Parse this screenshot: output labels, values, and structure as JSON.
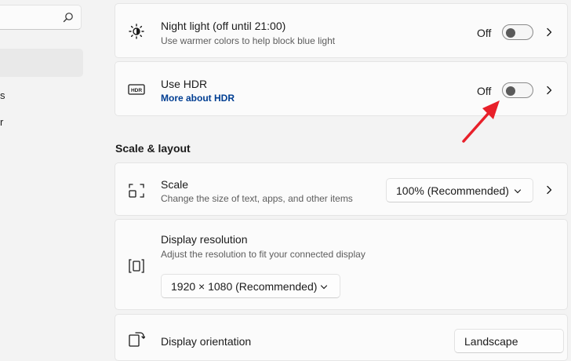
{
  "sidebar": {
    "search_icon": "search-icon",
    "nav_fragments": [
      "s",
      "r"
    ]
  },
  "night_light": {
    "icon": "brightness-icon",
    "title": "Night light (off until 21:00)",
    "subtitle": "Use warmer colors to help block blue light",
    "state": "Off",
    "enabled": false
  },
  "hdr": {
    "icon": "hdr-icon",
    "icon_text": "HDR",
    "title": "Use HDR",
    "link": "More about HDR",
    "state": "Off",
    "enabled": false
  },
  "scale_layout": {
    "heading": "Scale & layout",
    "scale": {
      "icon": "scale-icon",
      "title": "Scale",
      "subtitle": "Change the size of text, apps, and other items",
      "value": "100% (Recommended)"
    },
    "resolution": {
      "icon": "resolution-icon",
      "title": "Display resolution",
      "subtitle": "Adjust the resolution to fit your connected display",
      "value": "1920 × 1080 (Recommended)"
    },
    "orientation": {
      "icon": "orientation-icon",
      "title": "Display orientation",
      "value": "Landscape"
    }
  },
  "annotation": {
    "arrow_color": "#e8202a"
  }
}
